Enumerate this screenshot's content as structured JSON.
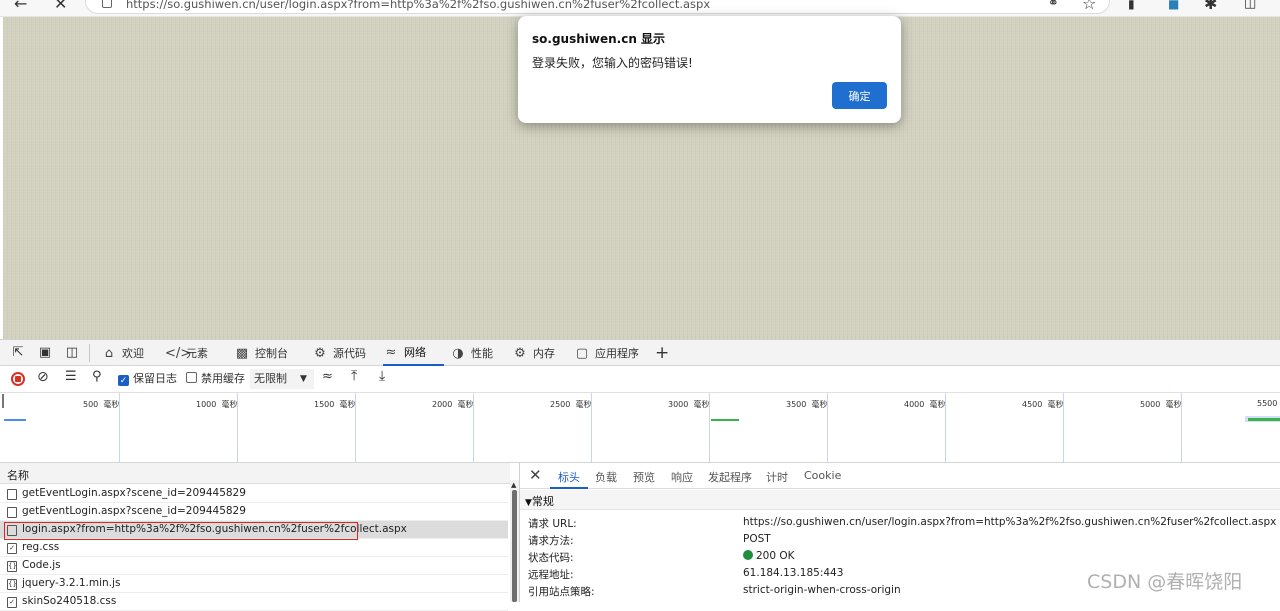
{
  "browser": {
    "url": "https://so.gushiwen.cn/user/login.aspx?from=http%3a%2f%2fso.gushiwen.cn%2fuser%2fcollect.aspx",
    "back_icon": "arrow-left-icon",
    "close_icon": "close-icon"
  },
  "dialog": {
    "title": "so.gushiwen.cn 显示",
    "message": "登录失败，您输入的密码错误!",
    "ok_label": "确定",
    "accent_color": "#1f6fd1"
  },
  "devtools": {
    "tabs": [
      {
        "label": "欢迎",
        "icon": "home-icon"
      },
      {
        "label": "元素",
        "icon": "code-icon"
      },
      {
        "label": "控制台",
        "icon": "console-icon"
      },
      {
        "label": "源代码",
        "icon": "bug-icon"
      },
      {
        "label": "网络",
        "icon": "wifi-icon",
        "active": true
      },
      {
        "label": "性能",
        "icon": "gauge-icon"
      },
      {
        "label": "内存",
        "icon": "memory-icon"
      },
      {
        "label": "应用程序",
        "icon": "app-icon"
      }
    ],
    "add_tab": "+"
  },
  "network_toolbar": {
    "preserve_log_label": "保留日志",
    "preserve_log_checked": true,
    "disable_cache_label": "禁用缓存",
    "disable_cache_checked": false,
    "throttle_value": "无限制"
  },
  "timeline": {
    "ticks": [
      {
        "value": "500",
        "unit": "毫秒"
      },
      {
        "value": "1000",
        "unit": "毫秒"
      },
      {
        "value": "1500",
        "unit": "毫秒"
      },
      {
        "value": "2000",
        "unit": "毫秒"
      },
      {
        "value": "2500",
        "unit": "毫秒"
      },
      {
        "value": "3000",
        "unit": "毫秒"
      },
      {
        "value": "3500",
        "unit": "毫秒"
      },
      {
        "value": "4000",
        "unit": "毫秒"
      },
      {
        "value": "4500",
        "unit": "毫秒"
      },
      {
        "value": "5000",
        "unit": "毫秒"
      },
      {
        "value": "5500",
        "unit": ""
      }
    ]
  },
  "requests": {
    "header": "名称",
    "rows": [
      {
        "name": "getEventLogin.aspx?scene_id=209445829",
        "icon": "document-icon"
      },
      {
        "name": "getEventLogin.aspx?scene_id=209445829",
        "icon": "document-icon"
      },
      {
        "name": "login.aspx?from=http%3a%2f%2fso.gushiwen.cn%2fuser%2fcollect.aspx",
        "icon": "document-icon",
        "selected": true
      },
      {
        "name": "reg.css",
        "icon": "stylesheet-icon"
      },
      {
        "name": "Code.js",
        "icon": "script-icon"
      },
      {
        "name": "jquery-3.2.1.min.js",
        "icon": "script-icon"
      },
      {
        "name": "skinSo240518.css",
        "icon": "stylesheet-icon"
      }
    ]
  },
  "detail": {
    "tabs": [
      "标头",
      "负载",
      "预览",
      "响应",
      "发起程序",
      "计时",
      "Cookie"
    ],
    "active_tab": "标头",
    "section": "常规",
    "fields": [
      {
        "key": "请求 URL:",
        "value": "https://so.gushiwen.cn/user/login.aspx?from=http%3a%2f%2fso.gushiwen.cn%2fuser%2fcollect.aspx"
      },
      {
        "key": "请求方法:",
        "value": "POST"
      },
      {
        "key": "状态代码:",
        "value": "200 OK"
      },
      {
        "key": "远程地址:",
        "value": "61.184.13.185:443"
      },
      {
        "key": "引用站点策略:",
        "value": "strict-origin-when-cross-origin"
      }
    ],
    "status_color": "#1e8e3e"
  },
  "watermark": "CSDN @春晖饶阳"
}
